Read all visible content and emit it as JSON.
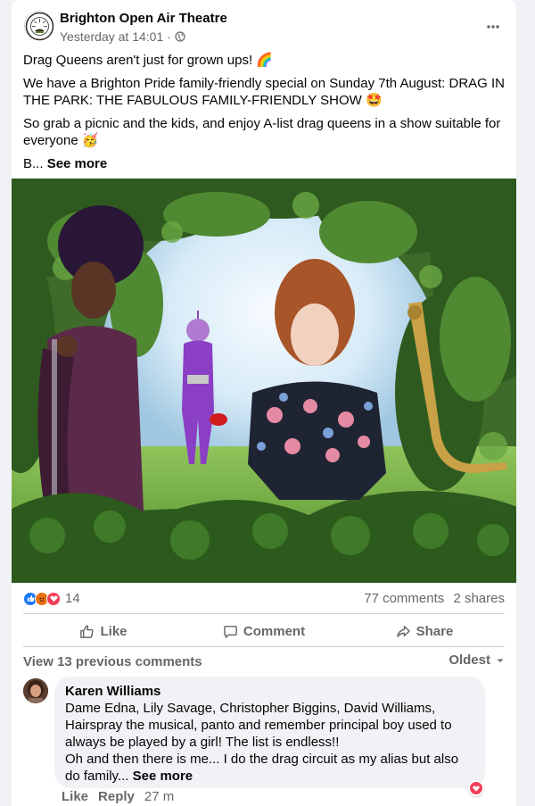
{
  "post": {
    "page_name": "Brighton Open Air Theatre",
    "timestamp": "Yesterday at 14:01",
    "separator": "·",
    "privacy_icon": "globe-icon",
    "more_icon": "more-options-icon",
    "paragraphs": [
      "Drag Queens aren't just for grown ups! 🌈",
      "We have a Brighton Pride family-friendly special on Sunday 7th August: DRAG IN THE PARK: THE FABULOUS FAMILY-FRIENDLY SHOW 🤩",
      "So grab a picnic and the kids, and enjoy A-list drag queens in a show suitable for everyone 🥳"
    ],
    "truncated_text": "B...",
    "see_more": "See more"
  },
  "stats": {
    "reaction_icons": [
      "like-reaction-icon",
      "angry-reaction-icon",
      "love-reaction-icon"
    ],
    "reaction_count": "14",
    "comments": "77 comments",
    "shares": "2 shares"
  },
  "actions": {
    "like": "Like",
    "comment": "Comment",
    "share": "Share"
  },
  "comments_section": {
    "view_previous": "View 13 previous comments",
    "sort": "Oldest"
  },
  "comment": {
    "author": "Karen Williams",
    "text": "Dame Edna, Lily Savage, Christopher Biggins, David Williams, Hairspray the musical, panto and remember principal boy used to always be played by a girl! The list is endless!!\nOh and then there is me... I do the drag circuit as my alias but also do family...",
    "see_more": "See more",
    "like": "Like",
    "reply": "Reply",
    "age": "27 m",
    "reaction_icon": "love-reaction-icon"
  },
  "colors": {
    "like_blue": "#1877f2",
    "love_red": "#f33e58",
    "angry_orange": "#e9710f",
    "secondary_text": "#65676b"
  }
}
